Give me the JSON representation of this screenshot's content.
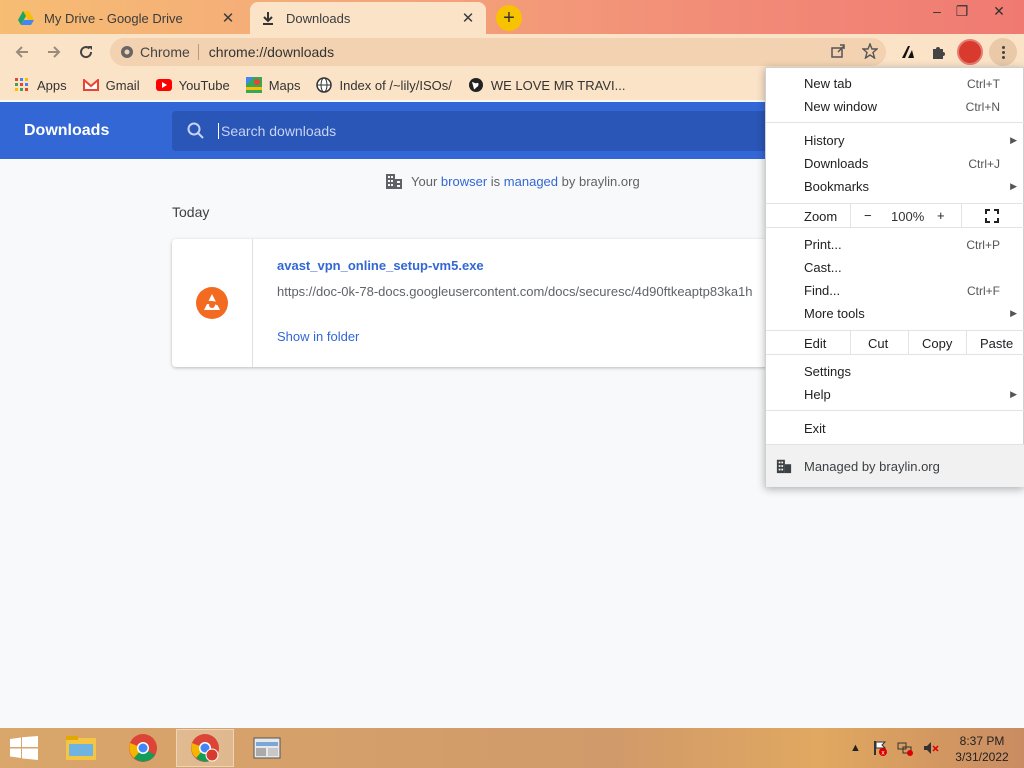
{
  "tabs": [
    {
      "title": "My Drive - Google Drive",
      "icon": "google-drive-icon",
      "active": false
    },
    {
      "title": "Downloads",
      "icon": "download-icon",
      "active": true
    }
  ],
  "window_controls": {
    "minimize": "–",
    "restore": "❐",
    "close": "✕"
  },
  "toolbar": {
    "chip_label": "Chrome",
    "url": "chrome://downloads"
  },
  "bookmarks": [
    {
      "label": "Apps",
      "icon": "apps-grid-icon"
    },
    {
      "label": "Gmail",
      "icon": "gmail-icon"
    },
    {
      "label": "YouTube",
      "icon": "youtube-icon"
    },
    {
      "label": "Maps",
      "icon": "maps-icon"
    },
    {
      "label": "Index of /~lily/ISOs/",
      "icon": "globe-icon"
    },
    {
      "label": "WE LOVE MR TRAVI...",
      "icon": "globe-icon"
    }
  ],
  "downloads_page": {
    "title": "Downloads",
    "search_placeholder": "Search downloads",
    "managed_prefix": "Your",
    "managed_link1": "browser",
    "managed_mid": "is",
    "managed_link2": "managed",
    "managed_suffix": "by braylin.org",
    "section": "Today",
    "item": {
      "filename": "avast_vpn_online_setup-vm5.exe",
      "url": "https://doc-0k-78-docs.googleusercontent.com/docs/securesc/4d90ftkeaptp83ka1h",
      "action": "Show in folder"
    }
  },
  "menu": {
    "new_tab": {
      "label": "New tab",
      "shortcut": "Ctrl+T"
    },
    "new_window": {
      "label": "New window",
      "shortcut": "Ctrl+N"
    },
    "history": {
      "label": "History"
    },
    "downloads": {
      "label": "Downloads",
      "shortcut": "Ctrl+J"
    },
    "bookmarks": {
      "label": "Bookmarks"
    },
    "zoom": {
      "label": "Zoom",
      "minus": "−",
      "value": "100%",
      "plus": "+"
    },
    "print": {
      "label": "Print...",
      "shortcut": "Ctrl+P"
    },
    "cast": {
      "label": "Cast..."
    },
    "find": {
      "label": "Find...",
      "shortcut": "Ctrl+F"
    },
    "more_tools": {
      "label": "More tools"
    },
    "edit": {
      "label": "Edit",
      "cut": "Cut",
      "copy": "Copy",
      "paste": "Paste"
    },
    "settings": {
      "label": "Settings"
    },
    "help": {
      "label": "Help"
    },
    "exit": {
      "label": "Exit"
    },
    "managed": {
      "label": "Managed by braylin.org"
    }
  },
  "taskbar": {
    "time": "8:37 PM",
    "date": "3/31/2022"
  },
  "colors": {
    "accent": "#3367d6",
    "tab_active_bg": "#fbe3c8",
    "avast_orange": "#f26b20"
  }
}
